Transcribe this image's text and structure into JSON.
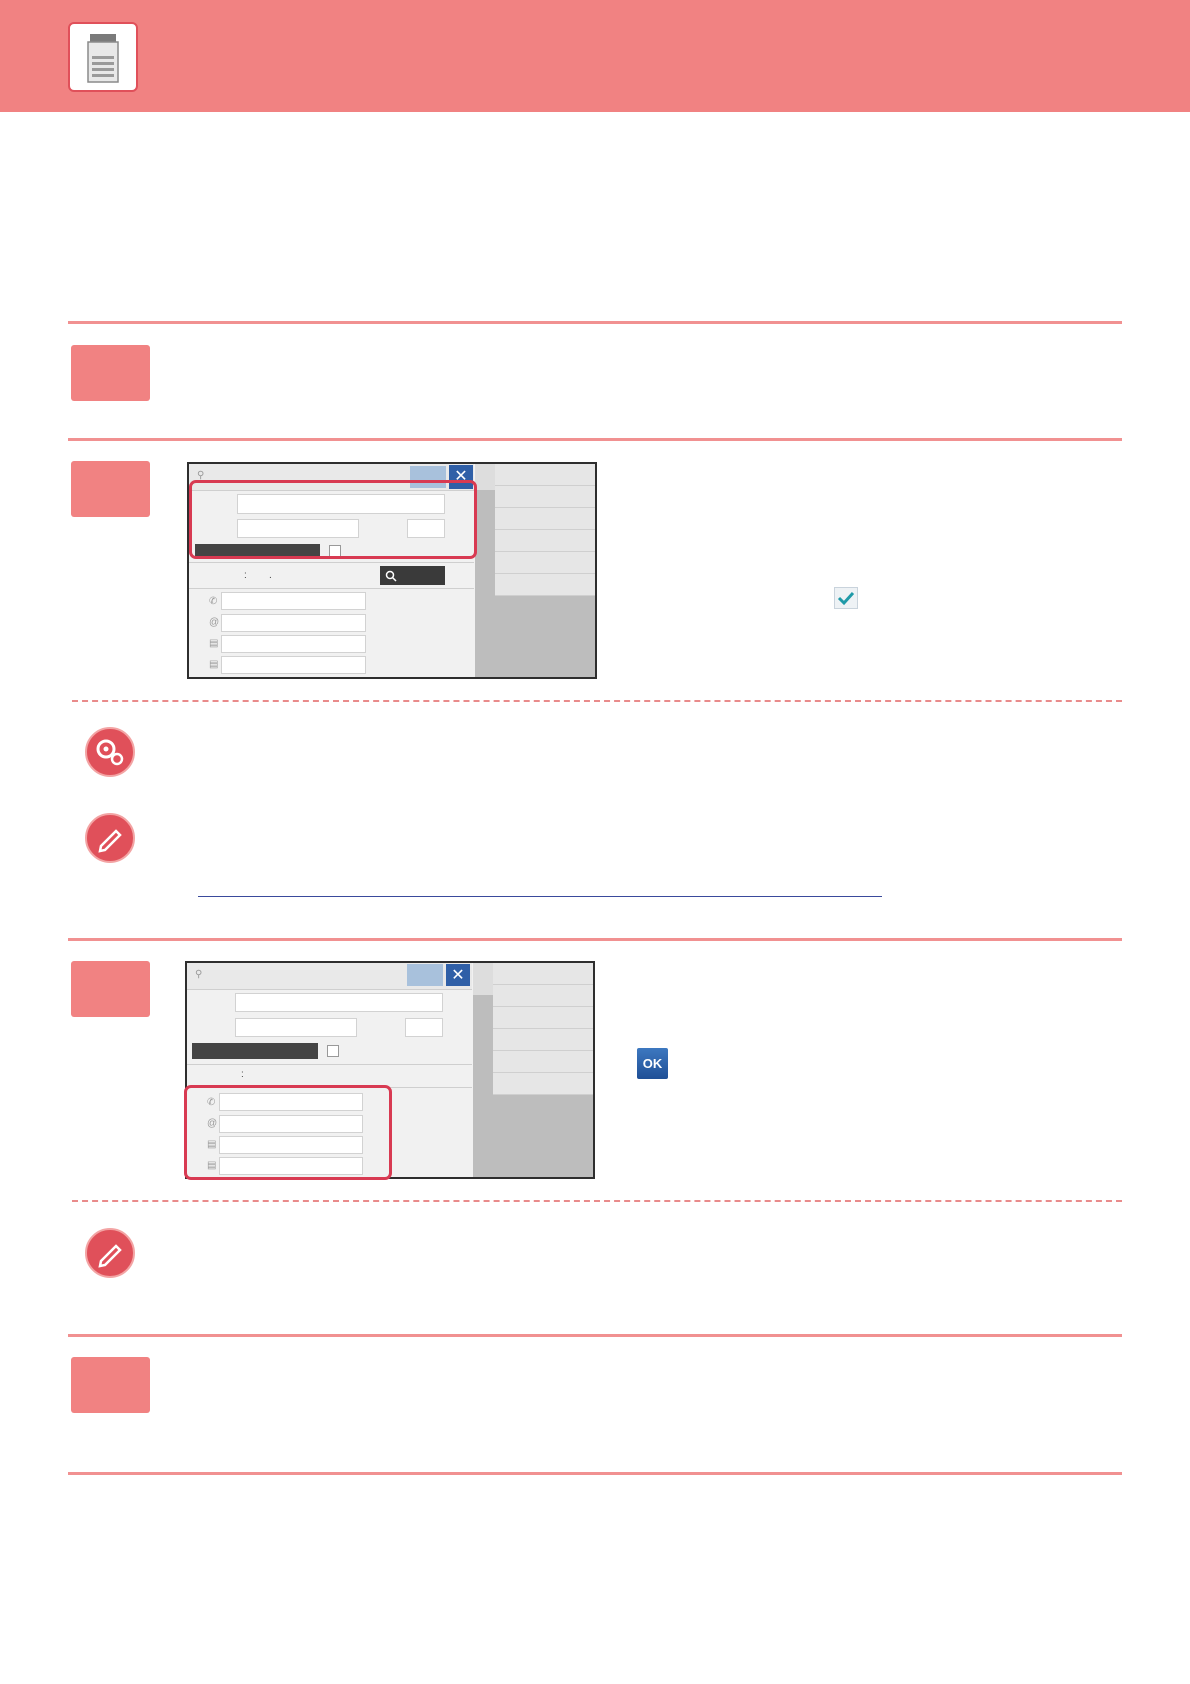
{
  "header": {
    "icon": "multifunction-printer-icon",
    "accent": "#f18282"
  },
  "screenshot_ui": {
    "close_glyph": "✕",
    "ok_label": "OK",
    "colon": ":",
    "dot": "."
  },
  "icons": {
    "settings": "settings-gears-icon",
    "note": "pencil-note-icon",
    "check": "checkmark-icon"
  },
  "colors": {
    "highlight": "#d83a52",
    "rule": "#f19191",
    "ok_button": "#2f5fa7"
  }
}
